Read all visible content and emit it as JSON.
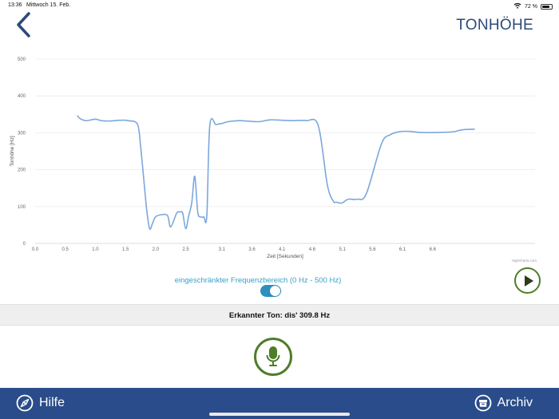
{
  "status_bar": {
    "time": "13:36",
    "date": "Mittwoch 15. Feb.",
    "battery": "72 %",
    "battery_level": 0.72
  },
  "header": {
    "title": "TONHÖHE",
    "back_icon": "chevron-left-icon"
  },
  "chart_data": {
    "type": "line",
    "xlabel": "Zeit [Sekunden]",
    "ylabel": "Tonhöhe [Hz]",
    "xlim": [
      0,
      8.3
    ],
    "ylim": [
      0,
      500
    ],
    "x_ticks": [
      "0.0",
      "0.5",
      "1.0",
      "1.5",
      "2.0",
      "2.5",
      "3.1",
      "3.6",
      "4.1",
      "4.6",
      "5.1",
      "5.6",
      "6.1",
      "6.6"
    ],
    "y_ticks": [
      "0",
      "100",
      "200",
      "300",
      "400",
      "500"
    ],
    "grid": true,
    "credits": "Highcharts.com",
    "series": [
      {
        "color": "#7ba7dd",
        "x": [
          0.7,
          0.75,
          0.85,
          1.0,
          1.1,
          1.25,
          1.4,
          1.55,
          1.7,
          1.75,
          1.8,
          1.85,
          1.9,
          1.95,
          2.0,
          2.1,
          2.2,
          2.25,
          2.35,
          2.4,
          2.45,
          2.5,
          2.55,
          2.6,
          2.65,
          2.7,
          2.75,
          2.8,
          2.85,
          2.9,
          3.0,
          3.05,
          3.1,
          3.2,
          3.4,
          3.7,
          3.9,
          4.1,
          4.3,
          4.5,
          4.7,
          4.85,
          4.95,
          5.0,
          5.05,
          5.1,
          5.2,
          5.35,
          5.5,
          5.75,
          5.9,
          6.05,
          6.2,
          6.4,
          6.7,
          6.95,
          7.05,
          7.15,
          7.3
        ],
        "y": [
          347,
          338,
          333,
          337,
          333,
          332,
          334,
          333,
          323,
          265,
          180,
          95,
          40,
          55,
          72,
          78,
          75,
          45,
          82,
          85,
          82,
          40,
          75,
          110,
          182,
          85,
          72,
          72,
          75,
          320,
          322,
          324,
          325,
          330,
          333,
          330,
          335,
          334,
          333,
          333,
          320,
          160,
          115,
          112,
          110,
          110,
          120,
          120,
          135,
          270,
          295,
          303,
          304,
          301,
          301,
          303,
          307,
          309,
          310
        ]
      }
    ]
  },
  "range_toggle": {
    "label": "eingeschränkter Frequenzbereich (0 Hz - 500 Hz)",
    "on": true,
    "color": "#2e8fc0"
  },
  "detected": {
    "text": "Erkannter Ton: dis'  309.8  Hz"
  },
  "buttons": {
    "play_icon": "play-icon",
    "mic_icon": "microphone-icon",
    "accent_green": "#4f7d2a"
  },
  "bottom_bar": {
    "help_label": "Hilfe",
    "help_icon": "compass-icon",
    "archive_label": "Archiv",
    "archive_icon": "archive-icon",
    "background": "#2b4c8a"
  }
}
